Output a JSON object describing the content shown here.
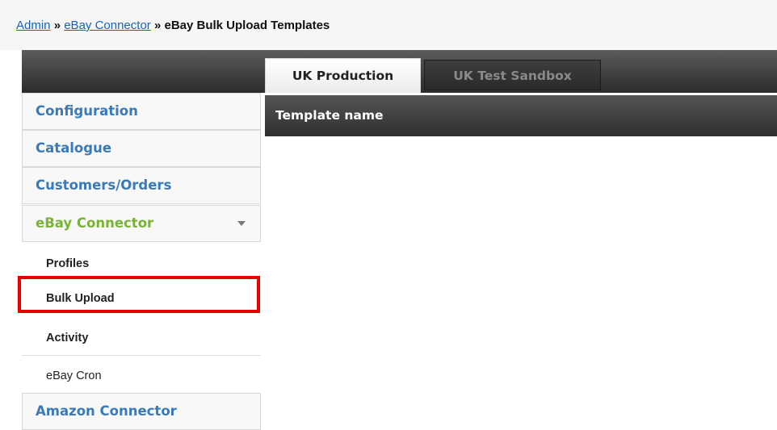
{
  "breadcrumb": {
    "admin": "Admin",
    "ebay_connector": "eBay Connector",
    "current": "eBay Bulk Upload Templates",
    "separator": "»"
  },
  "tabs": [
    {
      "label": "UK Production",
      "active": true
    },
    {
      "label": "UK Test Sandbox",
      "active": false
    }
  ],
  "table": {
    "header": "Template name"
  },
  "sidebar": {
    "items": [
      {
        "label": "Configuration"
      },
      {
        "label": "Catalogue"
      },
      {
        "label": "Customers/Orders"
      },
      {
        "label": "eBay Connector",
        "expanded": true
      },
      {
        "label": "Amazon Connector"
      }
    ],
    "sub_items": [
      {
        "label": "Profiles"
      },
      {
        "label": "Bulk Upload"
      },
      {
        "label": "Activity"
      },
      {
        "label": "eBay Cron"
      }
    ]
  },
  "colors": {
    "link": "#1a62b8",
    "menu_text": "#3a7ab8",
    "active_menu_text": "#78b436",
    "highlight_border": "#e60000"
  }
}
